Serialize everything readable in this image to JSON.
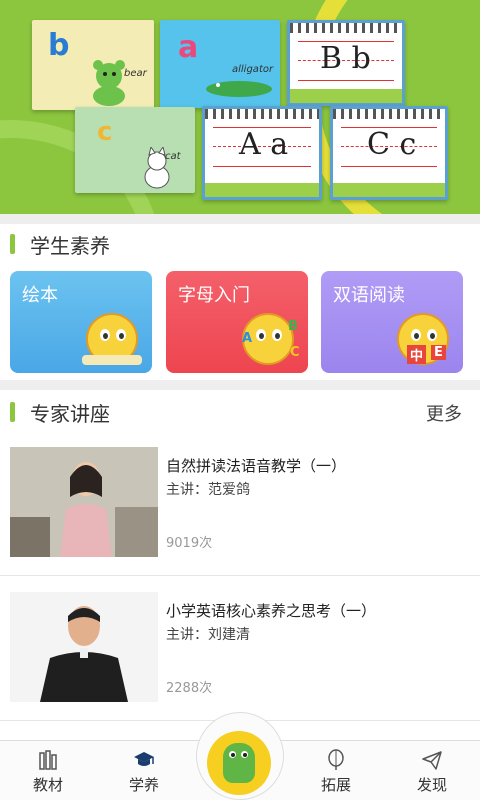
{
  "colors": {
    "accent_green": "#8cc63f",
    "banner_yellow": "#f5e33a",
    "tile_blue": "#5ab4ea",
    "tile_red": "#f0505a",
    "tile_purple": "#a48ef2"
  },
  "banner": {
    "cards": {
      "bear": {
        "letter": "b",
        "word": "bear"
      },
      "alligator": {
        "letter": "a",
        "word": "alligator"
      },
      "cat": {
        "letter": "c",
        "word": "cat"
      },
      "note_bb": {
        "text": "B b"
      },
      "note_aa": {
        "text": "A a"
      },
      "note_cc": {
        "text": "C c"
      }
    }
  },
  "student_section": {
    "title": "学生素养",
    "tiles": [
      {
        "label": "绘本",
        "icon": "mascot-reading-icon"
      },
      {
        "label": "字母入门",
        "icon": "mascot-abc-icon",
        "deco": [
          "A",
          "B",
          "C"
        ]
      },
      {
        "label": "双语阅读",
        "icon": "mascot-bilingual-icon",
        "deco": [
          "中",
          "E"
        ]
      }
    ]
  },
  "expert_section": {
    "title": "专家讲座",
    "more": "更多",
    "lectures": [
      {
        "title": "自然拼读法语音教学（一）",
        "speaker": "主讲：范爱鸽",
        "views": "9019次"
      },
      {
        "title": "小学英语核心素养之思考（一）",
        "speaker": "主讲：刘建清",
        "views": "2288次"
      }
    ]
  },
  "nav": {
    "items": [
      {
        "label": "教材",
        "icon": "books-icon"
      },
      {
        "label": "学养",
        "icon": "graduation-cap-icon"
      },
      {
        "label": "拓展",
        "icon": "balloon-icon"
      },
      {
        "label": "发现",
        "icon": "paper-plane-icon"
      }
    ],
    "center_icon": "dragon-mascot-icon"
  }
}
